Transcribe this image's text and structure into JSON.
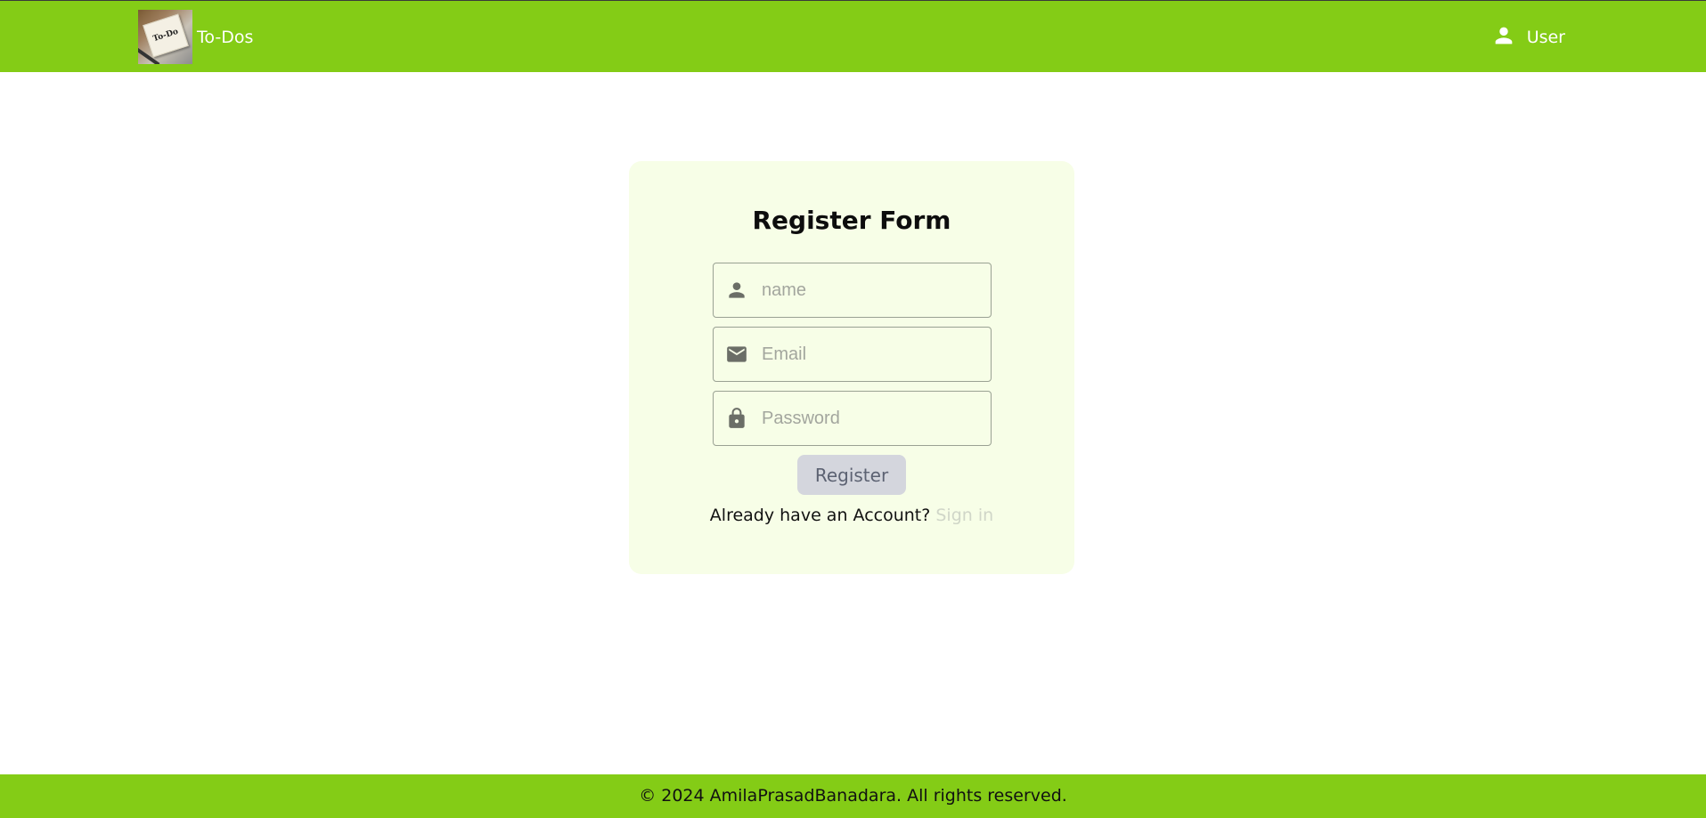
{
  "header": {
    "logo_text": "To-Do",
    "brand_name": "To-Dos",
    "user_label": "User"
  },
  "form": {
    "title": "Register Form",
    "fields": [
      {
        "icon": "person-icon",
        "placeholder": "name",
        "value": ""
      },
      {
        "icon": "mail-icon",
        "placeholder": "Email",
        "value": ""
      },
      {
        "icon": "lock-icon",
        "placeholder": "Password",
        "value": ""
      }
    ],
    "submit_label": "Register",
    "signin_prompt": "Already have an Account?",
    "signin_link": "Sign in"
  },
  "footer": {
    "copyright": "© 2024 AmilaPrasadBanadara. All rights reserved."
  },
  "colors": {
    "brand_green": "#84cc16",
    "card_background": "#f7fee7",
    "button_background": "#d4d6dd",
    "link_color": "#d0d6c8"
  }
}
